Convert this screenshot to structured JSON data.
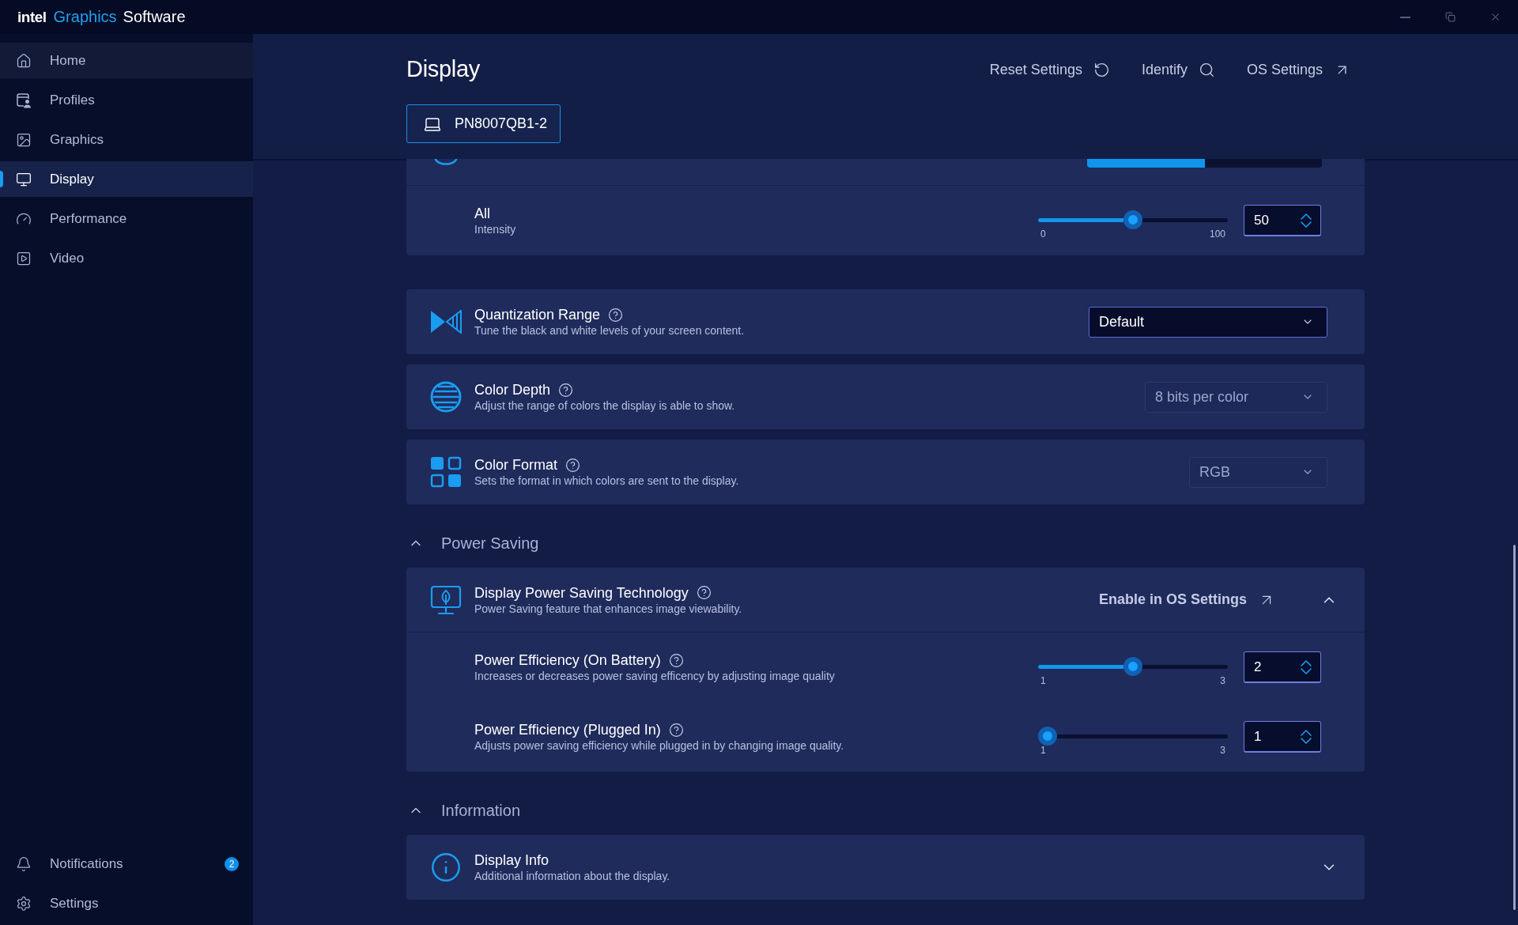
{
  "window": {
    "brand": "intel",
    "title_accent": "Graphics",
    "title": "Software"
  },
  "sidebar": {
    "items": [
      {
        "label": "Home",
        "selected": false,
        "hovered": true
      },
      {
        "label": "Profiles",
        "selected": false,
        "hovered": false
      },
      {
        "label": "Graphics",
        "selected": false,
        "hovered": false
      },
      {
        "label": "Display",
        "selected": true,
        "hovered": false
      },
      {
        "label": "Performance",
        "selected": false,
        "hovered": false
      },
      {
        "label": "Video",
        "selected": false,
        "hovered": false
      }
    ],
    "footer_items": [
      {
        "label": "Notifications",
        "badge": "2"
      },
      {
        "label": "Settings"
      }
    ]
  },
  "header": {
    "title": "Display",
    "actions": [
      {
        "label": "Reset Settings"
      },
      {
        "label": "Identify"
      },
      {
        "label": "OS Settings"
      }
    ],
    "displays": [
      {
        "label": "PN8007QB1-2",
        "selected": true
      }
    ]
  },
  "partial_card": {
    "segments": [
      {
        "selected": true
      },
      {
        "selected": false
      }
    ],
    "rows": [
      {
        "title": "All",
        "subtitle": "Intensity",
        "level": 0.5,
        "min": "0",
        "max": "100",
        "value": "50"
      }
    ]
  },
  "display_settings": [
    {
      "title": "Quantization Range",
      "description": "Tune the black and white levels of your screen content.",
      "value": "Default",
      "disabled": false
    },
    {
      "title": "Color Depth",
      "description": "Adjust the range of colors the display is able to show.",
      "value": "8 bits per color",
      "disabled": true
    },
    {
      "title": "Color Format",
      "description": "Sets the format in which colors are sent to the display.",
      "value": "RGB",
      "disabled": true
    }
  ],
  "sections": [
    {
      "heading": "Power Saving",
      "expanded": true,
      "cards": [
        {
          "title": "Display Power Saving Technology",
          "description": "Power Saving feature that enhances image viewability.",
          "link": "Enable in OS Settings",
          "expanded": true,
          "rows": [
            {
              "title": "Power Efficiency (On Battery)",
              "description": "Increases or decreases power saving efficency by adjusting image quality",
              "level": 0.5,
              "min": "1",
              "max": "3",
              "value": "2"
            },
            {
              "title": "Power Efficiency (Plugged In)",
              "description": "Adjusts power saving efficiency while plugged in by changing image quality.",
              "level": 0,
              "min": "1",
              "max": "3",
              "value": "1"
            }
          ]
        }
      ]
    },
    {
      "heading": "Information",
      "expanded": true,
      "cards": [
        {
          "title": "Display Info",
          "description": "Additional information about the display.",
          "expanded": false
        }
      ]
    }
  ]
}
